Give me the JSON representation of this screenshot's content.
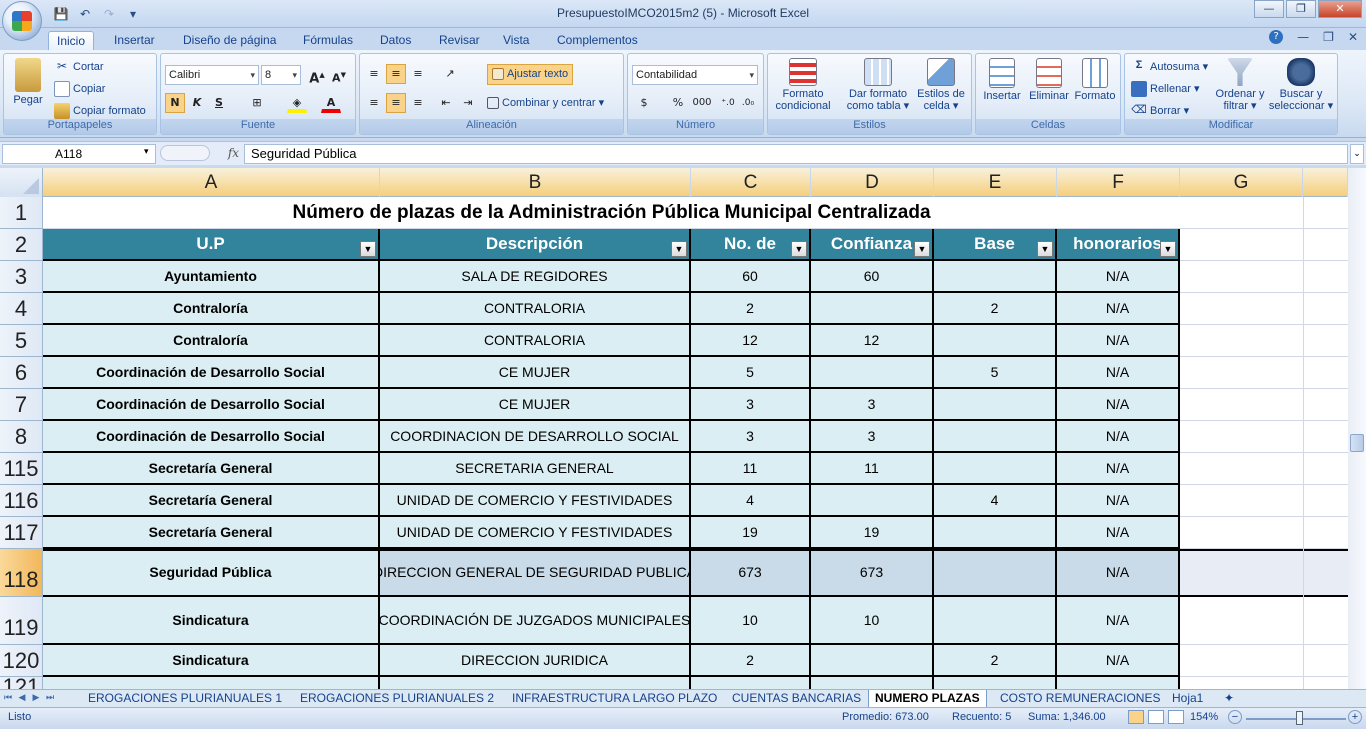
{
  "window": {
    "title": "PresupuestoIMCO2015m2 (5) - Microsoft Excel"
  },
  "ribbon_tabs": [
    "Inicio",
    "Insertar",
    "Diseño de página",
    "Fórmulas",
    "Datos",
    "Revisar",
    "Vista",
    "Complementos"
  ],
  "ribbon": {
    "clipboard": {
      "paste": "Pegar",
      "cut": "Cortar",
      "copy": "Copiar",
      "format_painter": "Copiar formato",
      "group": "Portapapeles"
    },
    "font": {
      "name": "Calibri",
      "size": "8",
      "bold": "N",
      "italic": "K",
      "underline": "S",
      "group": "Fuente"
    },
    "alignment": {
      "wrap": "Ajustar texto",
      "merge": "Combinar y centrar",
      "group": "Alineación"
    },
    "number": {
      "format": "Contabilidad",
      "currency": "$",
      "percent": "%",
      "thousands": "000",
      "group": "Número"
    },
    "styles": {
      "conditional": "Formato condicional",
      "as_table": "Dar formato como tabla",
      "cell_styles": "Estilos de celda",
      "group": "Estilos"
    },
    "cells": {
      "insert": "Insertar",
      "delete": "Eliminar",
      "format": "Formato",
      "group": "Celdas"
    },
    "editing": {
      "autosum": "Autosuma",
      "fill": "Rellenar",
      "clear": "Borrar",
      "sort": "Ordenar y filtrar",
      "find": "Buscar y seleccionar",
      "group": "Modificar"
    }
  },
  "formula_bar": {
    "name_box": "A118",
    "fx": "fx",
    "content": "Seguridad Pública"
  },
  "columns": [
    "A",
    "B",
    "C",
    "D",
    "E",
    "F",
    "G"
  ],
  "sheet": {
    "title": "Número de plazas de la Administración Pública Municipal Centralizada",
    "headers": [
      "U.P",
      "Descripción",
      "No. de",
      "Confianza",
      "Base",
      "honorarios"
    ],
    "rows": [
      {
        "row": "1"
      },
      {
        "row": "2"
      },
      {
        "row": "3",
        "up": "Ayuntamiento",
        "desc": "SALA DE REGIDORES",
        "no": "60",
        "conf": "60",
        "base": "",
        "hon": "N/A"
      },
      {
        "row": "4",
        "up": "Contraloría",
        "desc": "CONTRALORIA",
        "no": "2",
        "conf": "",
        "base": "2",
        "hon": "N/A"
      },
      {
        "row": "5",
        "up": "Contraloría",
        "desc": "CONTRALORIA",
        "no": "12",
        "conf": "12",
        "base": "",
        "hon": "N/A"
      },
      {
        "row": "6",
        "up": "Coordinación de Desarrollo Social",
        "desc": "CE MUJER",
        "no": "5",
        "conf": "",
        "base": "5",
        "hon": "N/A"
      },
      {
        "row": "7",
        "up": "Coordinación de Desarrollo Social",
        "desc": "CE MUJER",
        "no": "3",
        "conf": "3",
        "base": "",
        "hon": "N/A"
      },
      {
        "row": "8",
        "up": "Coordinación de Desarrollo Social",
        "desc": "COORDINACION DE DESARROLLO SOCIAL",
        "no": "3",
        "conf": "3",
        "base": "",
        "hon": "N/A"
      },
      {
        "row": "115",
        "up": "Secretaría General",
        "desc": "SECRETARIA GENERAL",
        "no": "11",
        "conf": "11",
        "base": "",
        "hon": "N/A"
      },
      {
        "row": "116",
        "up": "Secretaría General",
        "desc": "UNIDAD DE COMERCIO Y FESTIVIDADES",
        "no": "4",
        "conf": "",
        "base": "4",
        "hon": "N/A"
      },
      {
        "row": "117",
        "up": "Secretaría General",
        "desc": "UNIDAD DE COMERCIO Y FESTIVIDADES",
        "no": "19",
        "conf": "19",
        "base": "",
        "hon": "N/A"
      },
      {
        "row": "118",
        "up": "Seguridad Pública",
        "desc": "DIRECCION GENERAL DE SEGURIDAD PUBLICA",
        "no": "673",
        "conf": "673",
        "base": "",
        "hon": "N/A"
      },
      {
        "row": "119",
        "up": "Sindicatura",
        "desc": "COORDINACIÓN DE JUZGADOS MUNICIPALES",
        "no": "10",
        "conf": "10",
        "base": "",
        "hon": "N/A"
      },
      {
        "row": "120",
        "up": "Sindicatura",
        "desc": "DIRECCION JURIDICA",
        "no": "2",
        "conf": "",
        "base": "2",
        "hon": "N/A"
      },
      {
        "row": "121"
      }
    ]
  },
  "sheet_tabs": [
    "EROGACIONES PLURIANUALES 1",
    "EROGACIONES PLURIANUALES 2",
    "INFRAESTRUCTURA LARGO PLAZO",
    "CUENTAS BANCARIAS",
    "NUMERO PLAZAS",
    "COSTO REMUNERACIONES",
    "Hoja1"
  ],
  "active_sheet": "NUMERO PLAZAS",
  "status": {
    "mode": "Listo",
    "average": "Promedio: 673.00",
    "count": "Recuento: 5",
    "sum": "Suma: 1,346.00",
    "zoom": "154%"
  }
}
